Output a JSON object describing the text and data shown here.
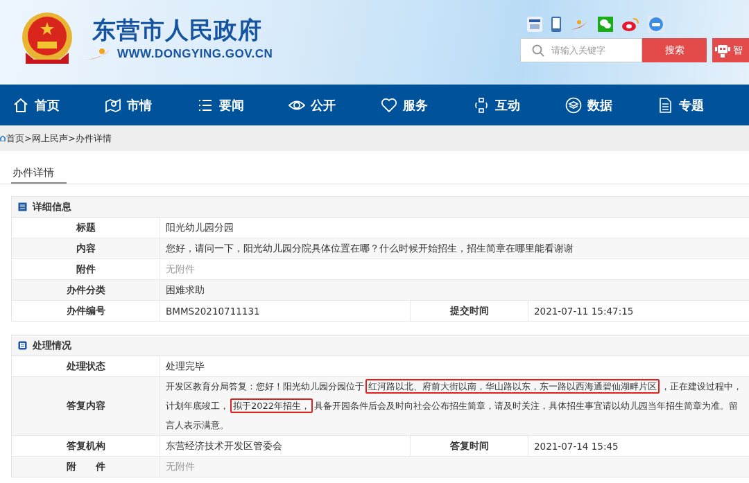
{
  "header": {
    "site_title": "东营市人民政府",
    "site_url": "WWW.DONGYING.GOV.CN",
    "search": {
      "placeholder": "请输入关键字",
      "button": "搜索"
    },
    "assistant_button": "智"
  },
  "nav": [
    {
      "label": "首页"
    },
    {
      "label": "市情"
    },
    {
      "label": "要闻"
    },
    {
      "label": "公开"
    },
    {
      "label": "服务"
    },
    {
      "label": "互动"
    },
    {
      "label": "数据"
    },
    {
      "label": "专题"
    }
  ],
  "breadcrumb": "首页>网上民声>办件详情",
  "tab": {
    "label": "办件详情"
  },
  "sections": [
    {
      "title": "详细信息",
      "rows": [
        {
          "kind": "field",
          "label": "标题",
          "value": "阳光幼儿园分园",
          "muted": false
        },
        {
          "kind": "field",
          "label": "内容",
          "value": "您好，请问一下，阳光幼儿园分院具体位置在哪？什么时候开始招生，招生简章在哪里能看谢谢",
          "muted": false
        },
        {
          "kind": "field",
          "label": "附件",
          "value": "无附件",
          "muted": true
        },
        {
          "kind": "field",
          "label": "办件分类",
          "value": "困难求助",
          "muted": false
        },
        {
          "kind": "pair",
          "label": "办件编号",
          "value": "BMMS20210711131",
          "label2": "提交时间",
          "value2": "2021-07-11 15:47:15",
          "muted": false
        }
      ]
    },
    {
      "title": "处理情况",
      "rows": [
        {
          "kind": "field",
          "label": "处理状态",
          "value": "处理完毕",
          "muted": false
        },
        {
          "kind": "reply",
          "label": "答复内容",
          "segments": [
            {
              "text": "开发区教育分局答复：您好！阳光幼儿园分园位于",
              "boxed": false
            },
            {
              "text": "红河路以北、府前大街以南，华山路以东，东一路以西海通碧仙湖畔片区",
              "boxed": true
            },
            {
              "text": "，正在建设过程中，计划年底竣工，",
              "boxed": false
            },
            {
              "text": "拟于2022年招生，",
              "boxed": true
            },
            {
              "text": "具备开园条件后会及时向社会公布招生简章，请及时关注，具体招生事宜请以幼儿园当年招生简章为准。留言人表示满意。",
              "boxed": false
            }
          ],
          "muted": false
        },
        {
          "kind": "pair",
          "label": "答复机构",
          "value": "东营经济技术开发区管委会",
          "label2": "答复时间",
          "value2": "2021-07-14 15:45",
          "muted": false
        },
        {
          "kind": "field",
          "label": "附　　件",
          "value": "无附件",
          "muted": true
        }
      ]
    }
  ]
}
